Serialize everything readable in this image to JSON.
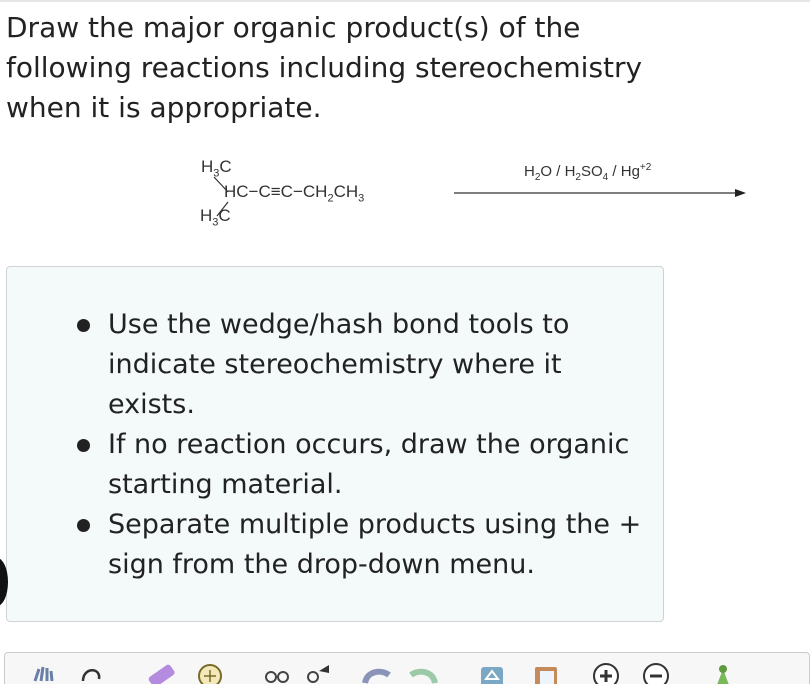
{
  "question": {
    "lines": [
      "Draw the major organic product(s) of the",
      "following reactions including stereochemistry",
      "when it is appropriate."
    ]
  },
  "reaction": {
    "substituent_top": "H3C",
    "main_chain": "HC−C≡C−CH2CH3",
    "substituent_bottom": "H3C",
    "reagents": "H2O / H2SO4 / Hg+2"
  },
  "instructions": [
    "Use the wedge/hash bond tools to indicate stereochemistry where it exists.",
    "If no reaction occurs, draw the organic starting material.",
    "Separate multiple products using the + sign from the drop-down menu."
  ],
  "toolbar": {
    "tools": [
      "hand-icon",
      "lasso-icon",
      "eraser-icon",
      "ring-template-icon",
      "chain-icon",
      "bond-icon",
      "undo-icon",
      "redo-icon",
      "template-icon",
      "paste-icon",
      "plus-charge-icon",
      "minus-charge-icon",
      "clean-icon"
    ]
  },
  "colors": {
    "hint_bg": "#f4f9fa",
    "hint_border": "#cdd3d6",
    "text": "#222222"
  }
}
